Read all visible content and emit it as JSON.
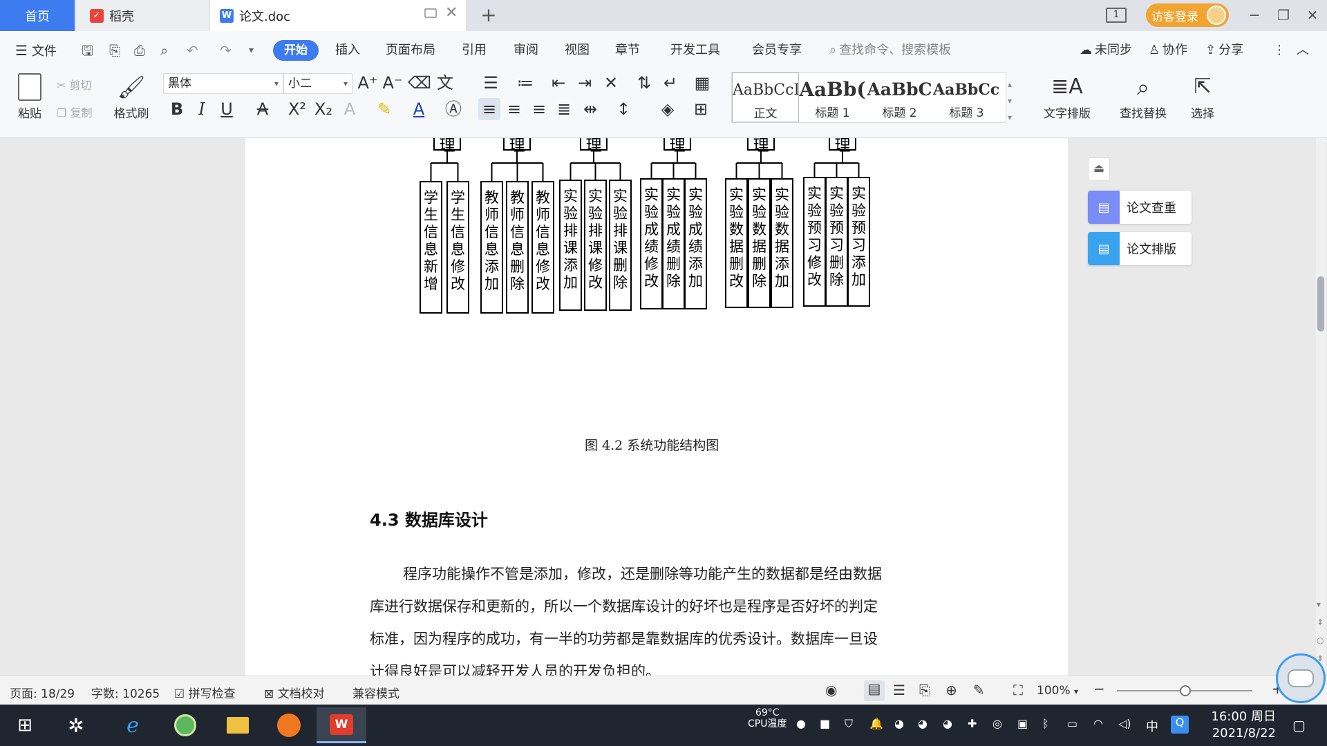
{
  "tabs": {
    "home": "首页",
    "docer": "稻壳",
    "doc": "论文.doc",
    "new_tab": "+"
  },
  "titlebar": {
    "visitor_login": "访客登录",
    "page_count_icon": "1"
  },
  "menu": {
    "file": "文件",
    "items": [
      "开始",
      "插入",
      "页面布局",
      "引用",
      "审阅",
      "视图",
      "章节",
      "开发工具",
      "会员专享"
    ],
    "search_placeholder": "查找命令、搜索模板",
    "unsynced": "未同步",
    "collaborate": "协作",
    "share": "分享"
  },
  "ribbon": {
    "paste": "粘贴",
    "cut": "剪切",
    "copy": "复制",
    "format_painter": "格式刷",
    "font_name": "黑体",
    "font_size": "小二",
    "styles": [
      {
        "preview": "AaBbCcI",
        "label": "正文"
      },
      {
        "preview": "AaBb(",
        "label": "标题 1"
      },
      {
        "preview": "AaBbC",
        "label": "标题 2"
      },
      {
        "preview": "AaBbCcl",
        "label": "标题 3"
      }
    ],
    "text_layout": "文字排版",
    "find_replace": "查找替换",
    "select": "选择"
  },
  "diagram": {
    "managers": [
      "管理",
      "管理",
      "管理",
      "管理",
      "管理",
      "管理"
    ],
    "groups": [
      [
        "学生信息新增",
        "学生信息修改"
      ],
      [
        "教师信息添加",
        "教师信息删除",
        "教师信息修改"
      ],
      [
        "实验排课添加",
        "实验排课修改",
        "实验排课删除"
      ],
      [
        "实验成绩修改",
        "实验成绩删除",
        "实验成绩添加"
      ],
      [
        "实验数据删改",
        "实验数据删除",
        "实验数据添加"
      ],
      [
        "实验预习修改",
        "实验预习删除",
        "实验预习添加"
      ]
    ]
  },
  "document": {
    "figure_caption": "图 4.2  系统功能结构图",
    "section_heading": "4.3  数据库设计",
    "paragraph_lines": [
      "程序功能操作不管是添加，修改，还是删除等功能产生的数据都是经由数据",
      "库进行数据保存和更新的，所以一个数据库设计的好坏也是程序是否好坏的判定",
      "标准，因为程序的成功，有一半的功劳都是靠数据库的优秀设计。数据库一旦设",
      "计得良好是可以减轻开发人员的开发负担的。"
    ]
  },
  "side_panel": {
    "paper_check": "论文查重",
    "paper_layout": "论文排版"
  },
  "statusbar": {
    "page": "页面: 18/29",
    "word_count": "字数: 10265",
    "spell_check": "拼写检查",
    "doc_proof": "文档校对",
    "compat_mode": "兼容模式",
    "zoom": "100%"
  },
  "taskbar": {
    "cpu_temp": "69°C",
    "cpu_label": "CPU温度",
    "ime": "中",
    "time": "16:00 周日",
    "date": "2021/8/22"
  },
  "colors": {
    "accent": "#3c7cf0",
    "visitor": "#f2a431",
    "taskbar": "#1f2630"
  }
}
